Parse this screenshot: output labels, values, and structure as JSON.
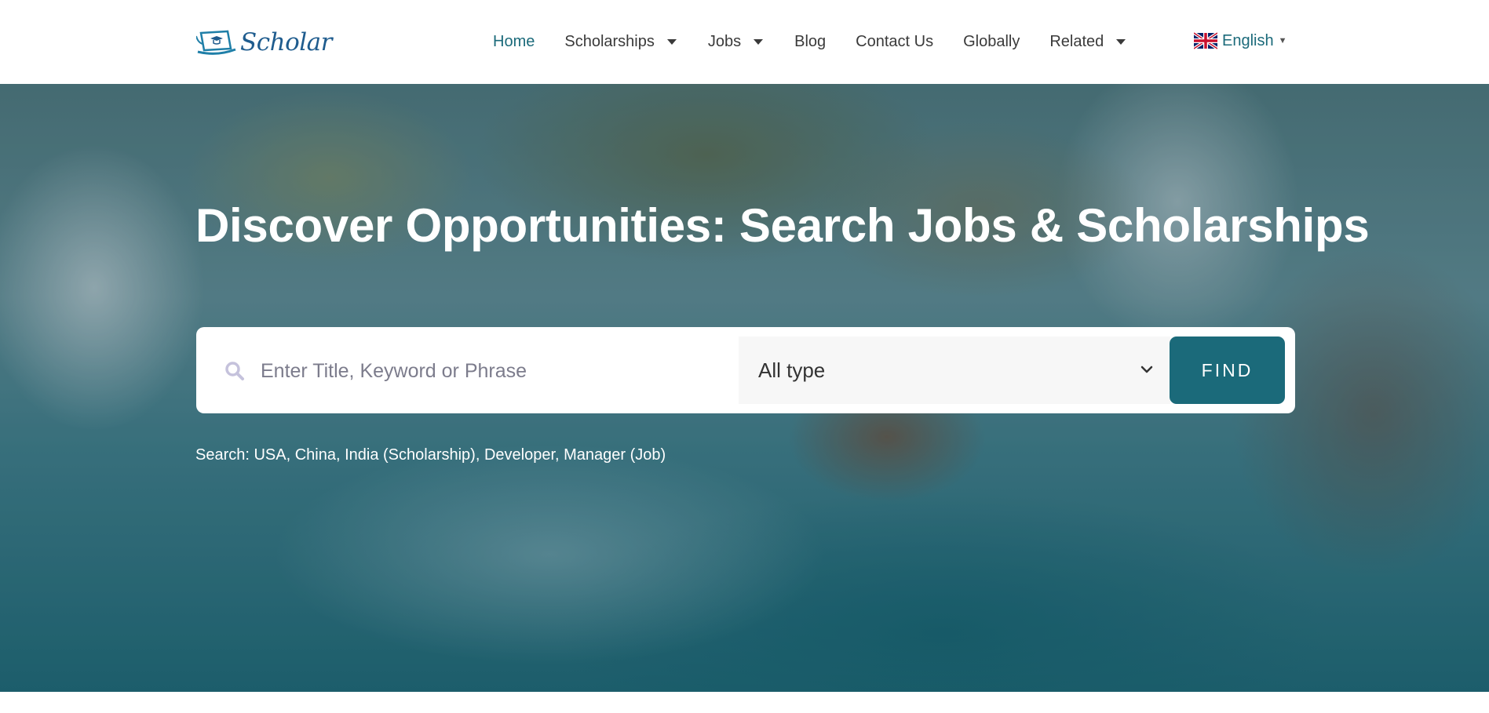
{
  "brand": {
    "name": "Scholar",
    "logo_icon": "laptop-graduation-icon"
  },
  "nav": {
    "items": [
      {
        "label": "Home",
        "active": true,
        "dropdown": false
      },
      {
        "label": "Scholarships",
        "active": false,
        "dropdown": true
      },
      {
        "label": "Jobs",
        "active": false,
        "dropdown": true
      },
      {
        "label": "Blog",
        "active": false,
        "dropdown": false
      },
      {
        "label": "Contact Us",
        "active": false,
        "dropdown": false
      },
      {
        "label": "Globally",
        "active": false,
        "dropdown": false
      },
      {
        "label": "Related",
        "active": false,
        "dropdown": true
      }
    ],
    "language": {
      "label": "English",
      "flag_icon": "uk-flag-icon"
    }
  },
  "hero": {
    "title": "Discover Opportunities: Search Jobs & Scholarships",
    "search": {
      "placeholder": "Enter Title, Keyword or Phrase",
      "value": "",
      "type_selected": "All type",
      "button_label": "FIND"
    },
    "suggestions": "Search: USA, China, India (Scholarship), Developer, Manager (Job)"
  },
  "colors": {
    "accent": "#1b6a7a",
    "nav_text": "#3a3a3a",
    "logo": "#1f5c8e",
    "search_bg": "#ffffff",
    "select_bg": "#f7f7f7"
  }
}
